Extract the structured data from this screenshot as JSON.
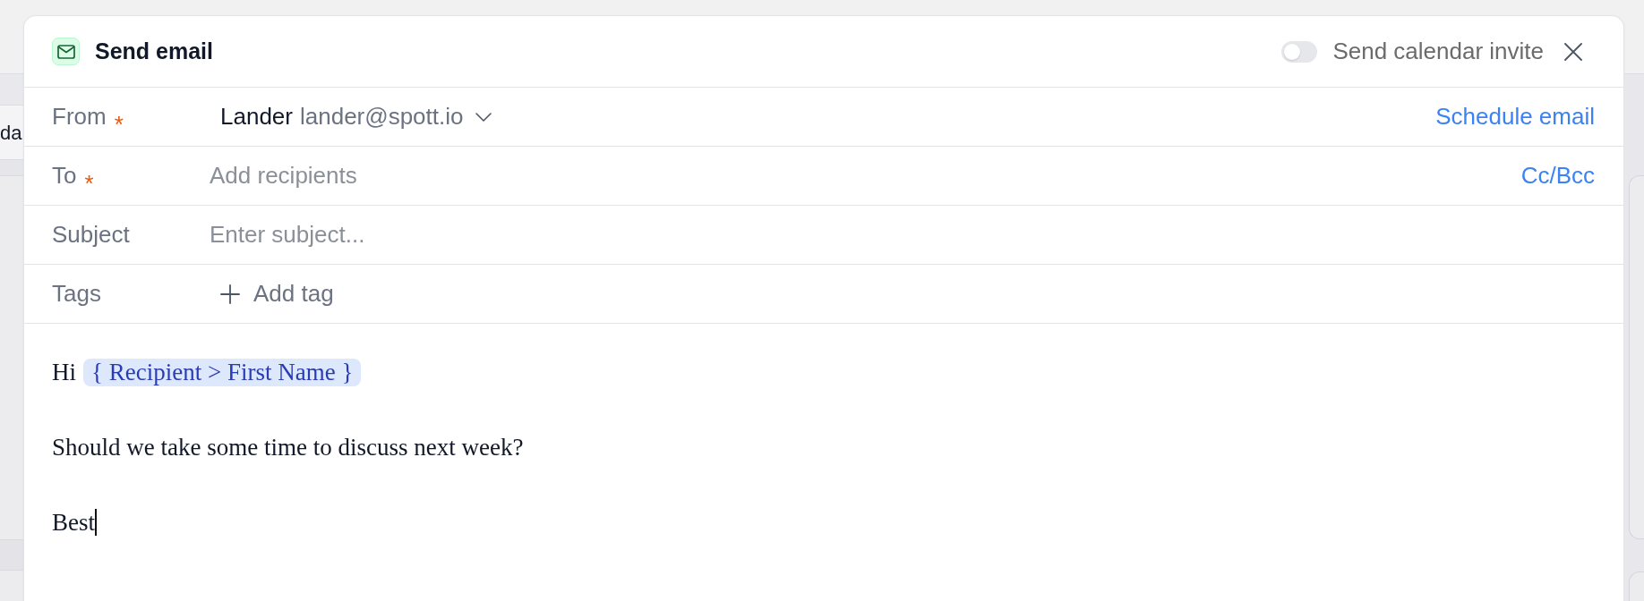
{
  "background": {
    "row_text": "da"
  },
  "modal": {
    "title": "Send email",
    "calendar_invite": {
      "label": "Send calendar invite",
      "on": false
    }
  },
  "fields": [
    {
      "kind": "sender",
      "label": "From",
      "required_mark": "*",
      "sender_name": "Lander",
      "sender_email": "lander@spott.io",
      "action": "Schedule email"
    },
    {
      "kind": "input",
      "label": "To",
      "required_mark": "*",
      "placeholder": "Add recipients",
      "action": "Cc/Bcc"
    },
    {
      "kind": "input",
      "label": "Subject",
      "placeholder": "Enter subject..."
    },
    {
      "kind": "tags",
      "label": "Tags",
      "button": "Add tag"
    }
  ],
  "body": [
    {
      "kind": "greeting",
      "text": "Hi",
      "variable": "{ Recipient > First Name }"
    },
    {
      "kind": "text",
      "text": "Should we take some time to discuss next week?"
    },
    {
      "kind": "text",
      "text": "Best",
      "cursor": true
    }
  ]
}
